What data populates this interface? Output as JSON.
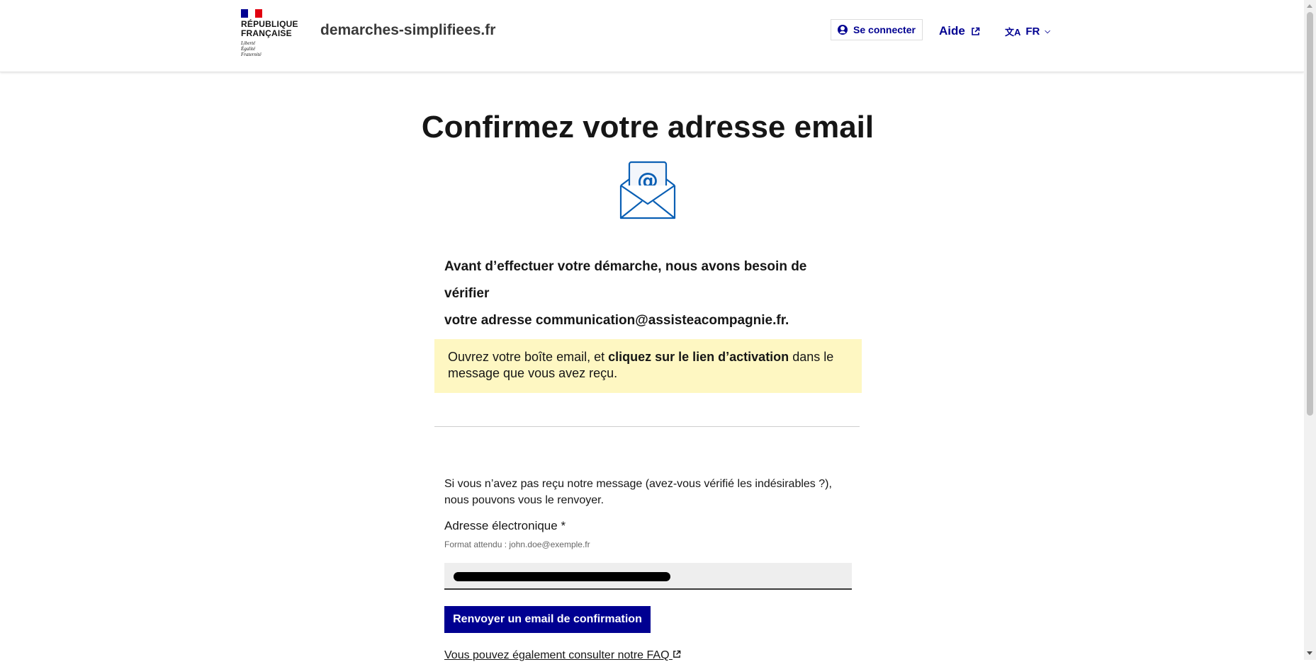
{
  "header": {
    "logo_lines": [
      "RÉPUBLIQUE",
      "FRANÇAISE"
    ],
    "logo_motto": [
      "Liberté",
      "Égalité",
      "Fraternité"
    ],
    "flag_colors": [
      "#000091",
      "#ffffff",
      "#e1000f"
    ],
    "site_name": "demarches-simplifiees.fr",
    "login_label": "Se connecter",
    "login_icon": "user-circle-icon",
    "help_label": "Aide",
    "help_icon": "external-link-icon",
    "lang_label": "FR",
    "lang_icon": "translate-icon"
  },
  "main": {
    "title": "Confirmez votre adresse email",
    "illustration": "envelope-at-icon",
    "intro_line1": "Avant d’effectuer votre démarche, nous avons besoin de vérifier",
    "intro_line2": "votre adresse communication@assisteacompagnie.fr.",
    "notice_prefix": "Ouvrez votre boîte email, et ",
    "notice_bold": "cliquez sur le lien d’activation",
    "notice_suffix": " dans le message que vous avez reçu.",
    "resend_text": "Si vous n’avez pas reçu notre message (avez-vous vérifié les indésirables ?), nous pouvons vous le renvoyer.",
    "email_label": "Adresse électronique",
    "required_mark": "*",
    "email_hint": "Format attendu : john.doe@exemple.fr",
    "email_value": "",
    "submit_label": "Renvoyer un email de confirmation",
    "faq_text": "Vous pouvez également consulter notre FAQ"
  },
  "colors": {
    "primary": "#000091",
    "notice_bg": "#fef7c2",
    "input_bg": "#eeeeee",
    "text": "#161616"
  }
}
